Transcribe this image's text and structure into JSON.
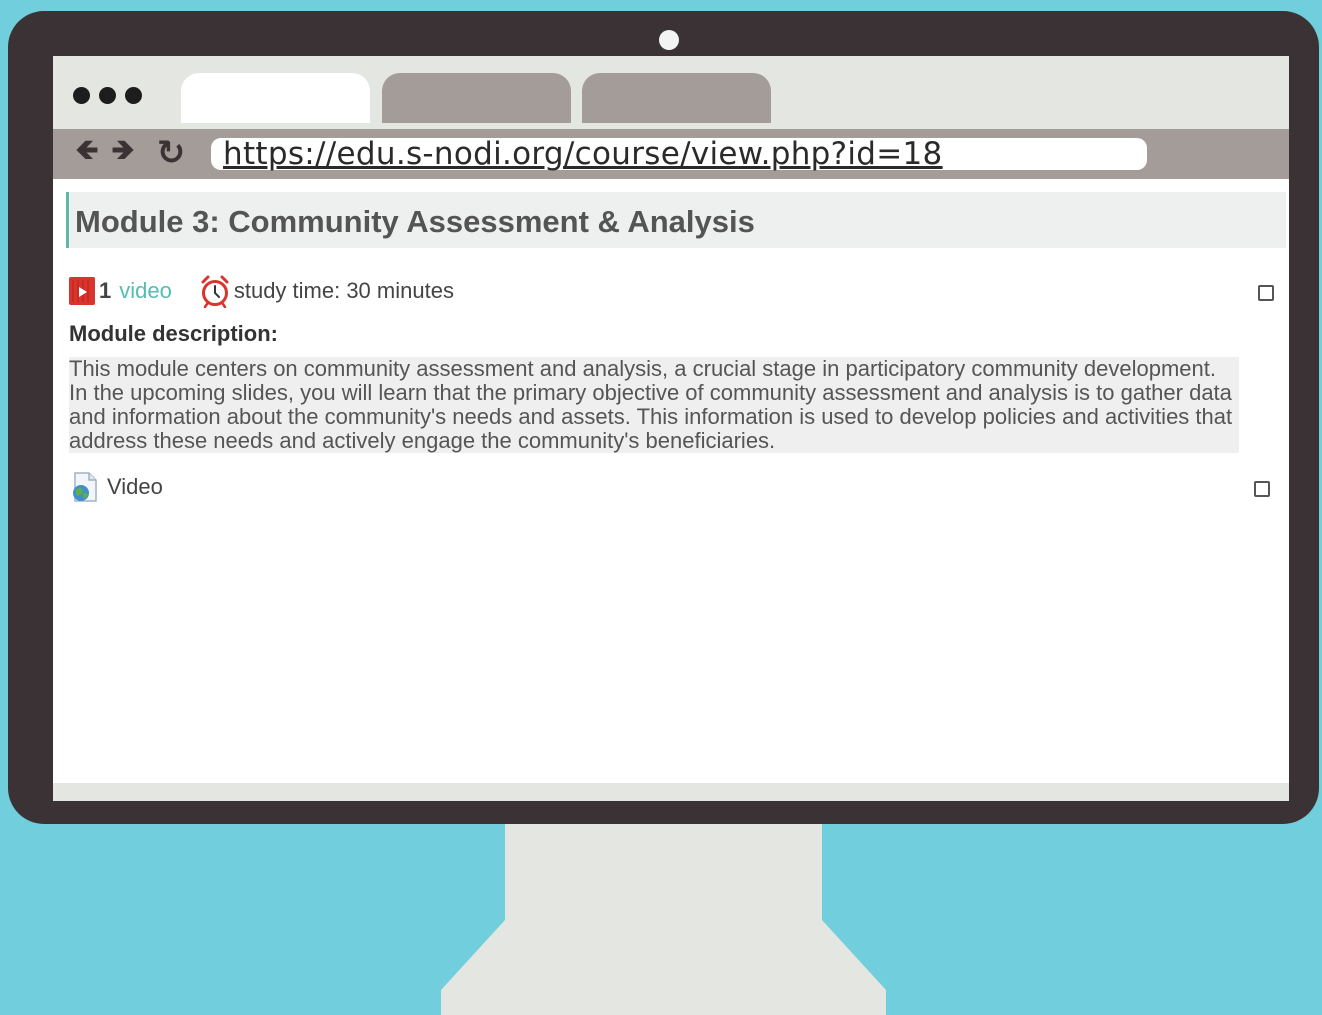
{
  "browser": {
    "url": "https://edu.s-nodi.org/course/view.php?id=18",
    "back_glyph": "🡸",
    "forward_glyph": "🡺",
    "reload_glyph": "↻"
  },
  "section": {
    "title": "Module 3: Community Assessment & Analysis",
    "video_count": "1",
    "video_count_link": "video",
    "study_time": "study time: 30 minutes",
    "description_label": "Module description:",
    "description": "This module centers on community assessment and analysis, a crucial stage in participatory community development. In the upcoming slides, you will learn that the primary objective of community assessment and analysis is to gather data and information about the community's needs and assets. This information is used to develop policies and activities that address these needs and actively engage the community's beneficiaries.",
    "activity_label": "Video"
  },
  "colors": {
    "background": "#71cedc",
    "monitor": "#3b3235",
    "accent": "#54bdb1",
    "video_icon": "#d9352f"
  },
  "icons": [
    "back-arrow-icon",
    "forward-arrow-icon",
    "reload-icon",
    "video-icon",
    "alarm-clock-icon",
    "url-page-icon"
  ]
}
